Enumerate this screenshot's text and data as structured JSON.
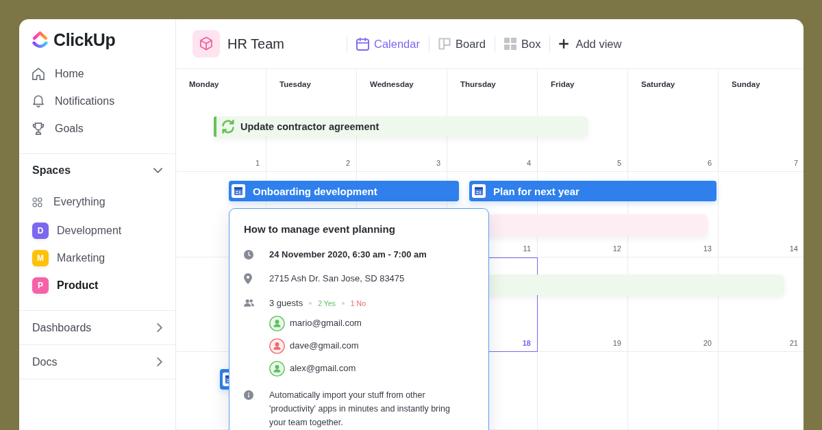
{
  "sidebar": {
    "brand": "ClickUp",
    "nav": [
      "Home",
      "Notifications",
      "Goals"
    ],
    "spaces": {
      "heading": "Spaces",
      "expanded": true,
      "items": [
        {
          "kind": "all",
          "label": "Everything",
          "selected": false
        },
        {
          "kind": "space",
          "initial": "D",
          "label": "Development",
          "color": "#7b68ee",
          "selected": false
        },
        {
          "kind": "space",
          "initial": "M",
          "label": "Marketing",
          "color": "#ffc107",
          "selected": false
        },
        {
          "kind": "space",
          "initial": "P",
          "label": "Product",
          "color": "#f661a8",
          "selected": true
        }
      ]
    },
    "sections": [
      {
        "label": "Dashboards",
        "expanded": false
      },
      {
        "label": "Docs",
        "expanded": false
      }
    ]
  },
  "header": {
    "title": "HR Team",
    "views": [
      {
        "label": "Calendar",
        "selected": true
      },
      {
        "label": "Board",
        "selected": false
      },
      {
        "label": "Box",
        "selected": false
      }
    ],
    "add_view": "Add view"
  },
  "calendar": {
    "weekdays": [
      "Monday",
      "Tuesday",
      "Wednesday",
      "Thursday",
      "Friday",
      "Saturday",
      "Sunday"
    ],
    "weeks": [
      {
        "days": [
          {
            "number": "1",
            "today": false
          },
          {
            "number": "2",
            "today": false
          },
          {
            "number": "3",
            "today": false
          },
          {
            "number": "4",
            "today": false
          },
          {
            "number": "5",
            "today": false
          },
          {
            "number": "6",
            "today": false
          },
          {
            "number": "7",
            "today": false
          }
        ],
        "events": [
          {
            "kind": "task",
            "title": "Update contractor agreement",
            "color": "#eef8ec"
          }
        ]
      },
      {
        "days": [
          {
            "number": "11",
            "today": false
          },
          {
            "number": "12",
            "today": false
          },
          {
            "number": "13",
            "today": false
          },
          {
            "number": "14",
            "today": false
          }
        ],
        "events": [
          {
            "kind": "google",
            "title": "Onboarding development",
            "color": "#2f80ed"
          },
          {
            "kind": "google",
            "title": "Plan for next year",
            "color": "#2f80ed"
          },
          {
            "kind": "task",
            "color": "#fdeef4"
          }
        ]
      },
      {
        "days": [
          {
            "number": "18",
            "today": true
          },
          {
            "number": "19",
            "today": false
          },
          {
            "number": "20",
            "today": false
          },
          {
            "number": "21",
            "today": false
          }
        ],
        "events": [
          {
            "kind": "task",
            "color": "#eef8ec"
          }
        ]
      },
      {
        "events": [
          {
            "kind": "google",
            "color": "#2f80ed"
          }
        ]
      }
    ]
  },
  "event_popup": {
    "title": "How to manage event planning",
    "time": "24 November 2020, 6:30 am - 7:00 am",
    "address": "2715 Ash Dr. San Jose, SD 83475",
    "guest_count": "3 guests",
    "yes": "2 Yes",
    "no": "1 No",
    "guests": [
      {
        "email": "mario@gmail.com",
        "accepted": true
      },
      {
        "email": "dave@gmail.com",
        "accepted": false
      },
      {
        "email": "alex@gmail.com",
        "accepted": true
      }
    ],
    "description": "Automatically import your stuff from other 'productivity' apps in minutes and instantly bring your team together."
  }
}
